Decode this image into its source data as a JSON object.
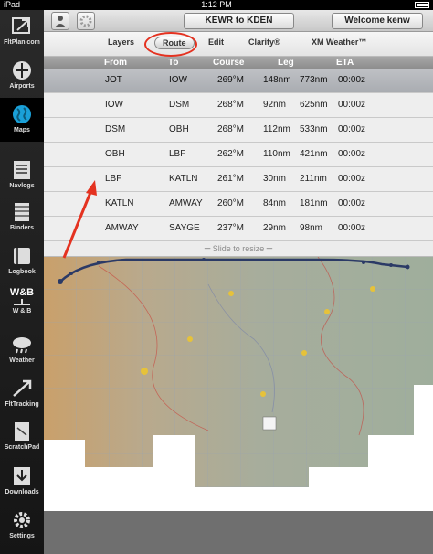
{
  "status": {
    "device": "iPad",
    "time": "1:12 PM"
  },
  "sidebar": {
    "items": [
      {
        "label": "FltPlan.com",
        "icon": "fltplan-icon"
      },
      {
        "label": "Airports",
        "icon": "airports-icon"
      },
      {
        "label": "Maps",
        "icon": "globe-icon",
        "active": true
      },
      {
        "label": "Navlogs",
        "icon": "navlog-icon"
      },
      {
        "label": "Binders",
        "icon": "binder-icon"
      },
      {
        "label": "Logbook",
        "icon": "logbook-icon"
      },
      {
        "label": "W & B",
        "icon": "weight-balance-icon",
        "sub": "W&B"
      },
      {
        "label": "Weather",
        "icon": "weather-icon"
      },
      {
        "label": "FltTracking",
        "icon": "tracking-icon"
      },
      {
        "label": "ScratchPad",
        "icon": "scratchpad-icon"
      },
      {
        "label": "Downloads",
        "icon": "download-icon"
      },
      {
        "label": "Settings",
        "icon": "gear-icon"
      }
    ]
  },
  "toolbar": {
    "route_button": "KEWR to KDEN",
    "welcome_button": "Welcome kenw"
  },
  "tabs": [
    "Layers",
    "Route",
    "Edit",
    "Clarity®",
    "XM Weather™"
  ],
  "route_table": {
    "headers": [
      "From",
      "To",
      "Course",
      "Leg",
      "ETA"
    ],
    "rows": [
      [
        "JOT",
        "IOW",
        "269°M",
        "148nm",
        "773nm",
        "00:00z"
      ],
      [
        "IOW",
        "DSM",
        "268°M",
        "92nm",
        "625nm",
        "00:00z"
      ],
      [
        "DSM",
        "OBH",
        "268°M",
        "112nm",
        "533nm",
        "00:00z"
      ],
      [
        "OBH",
        "LBF",
        "262°M",
        "110nm",
        "421nm",
        "00:00z"
      ],
      [
        "LBF",
        "KATLN",
        "261°M",
        "30nm",
        "211nm",
        "00:00z"
      ],
      [
        "KATLN",
        "AMWAY",
        "260°M",
        "84nm",
        "181nm",
        "00:00z"
      ],
      [
        "AMWAY",
        "SAYGE",
        "237°M",
        "29nm",
        "98nm",
        "00:00z"
      ]
    ]
  },
  "resize_hint": "Slide to resize",
  "colors": {
    "highlight": "#e43220",
    "route_line": "#2b3a66"
  }
}
